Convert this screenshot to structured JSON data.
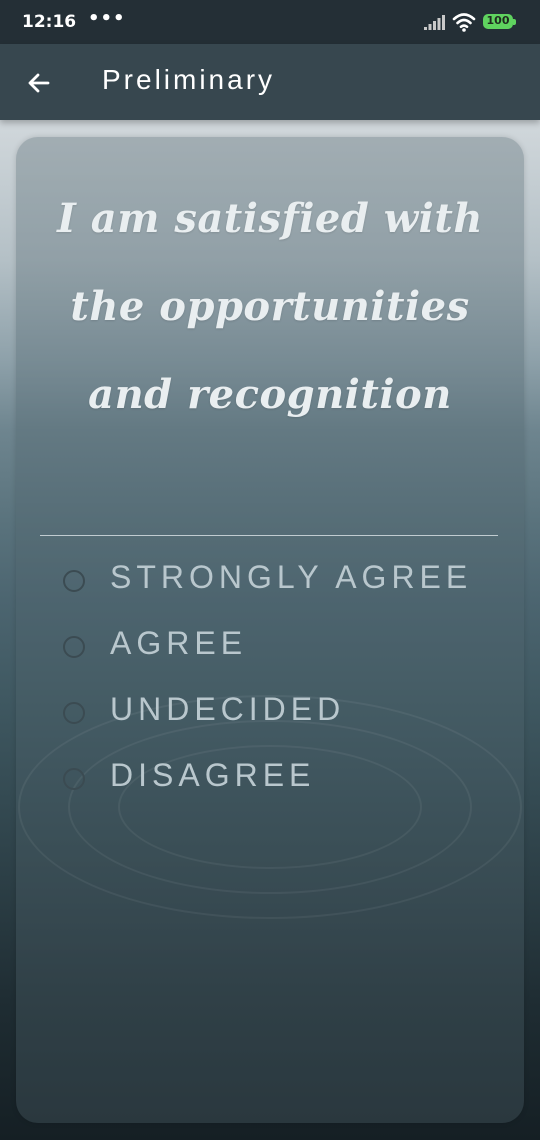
{
  "status_bar": {
    "time": "12:16",
    "dots": "•••",
    "battery": "100",
    "battery_color": "#5fd35f",
    "icons": [
      "signal-icon",
      "wifi-icon",
      "battery-icon"
    ]
  },
  "app_bar": {
    "title": "Preliminary",
    "back_icon": "arrow-left-icon",
    "background": "#37474f"
  },
  "question": {
    "text": "I am satisfied with the opportunities and recognition"
  },
  "options": [
    {
      "label": "STRONGLY AGREE",
      "selected": false
    },
    {
      "label": "AGREE",
      "selected": false
    },
    {
      "label": "UNDECIDED",
      "selected": false
    },
    {
      "label": "DISAGREE",
      "selected": false
    }
  ]
}
